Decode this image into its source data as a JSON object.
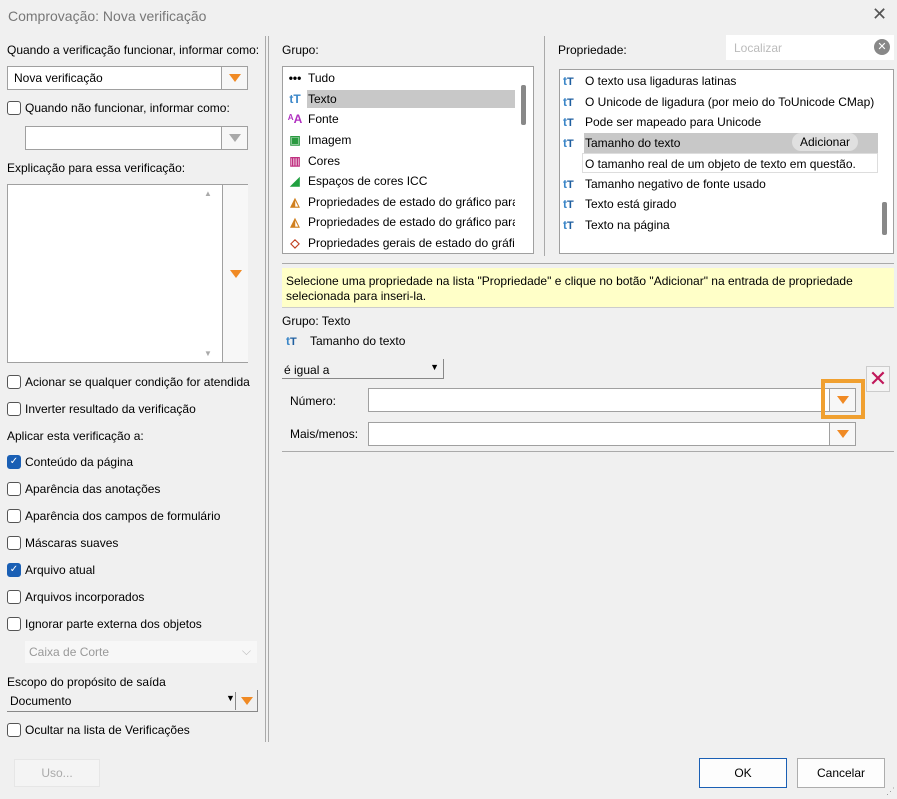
{
  "window": {
    "title": "Comprovação: Nova verificação",
    "close_icon": "close-icon"
  },
  "left": {
    "success_label": "Quando a verificação funcionar, informar como:",
    "success_value": "Nova verificação",
    "fail_label": "Quando não funcionar, informar como:",
    "fail_checked": false,
    "fail_value": "",
    "explanation_label": "Explicação para essa verificação:",
    "explanation_value": "",
    "options": [
      {
        "label": "Acionar se qualquer condição for atendida",
        "checked": false
      },
      {
        "label": "Inverter resultado da verificação",
        "checked": false
      }
    ],
    "apply_label": "Aplicar esta verificação a:",
    "apply": [
      {
        "label": "Conteúdo da página",
        "checked": true
      },
      {
        "label": "Aparência das anotações",
        "checked": false
      },
      {
        "label": "Aparência dos campos de formulário",
        "checked": false
      },
      {
        "label": "Máscaras suaves",
        "checked": false
      },
      {
        "label": "Arquivo atual",
        "checked": true
      },
      {
        "label": "Arquivos incorporados",
        "checked": false
      },
      {
        "label": "Ignorar parte externa dos objetos",
        "checked": false
      }
    ],
    "box_select": "Caixa de Corte",
    "scope_label": "Escopo do propósito de saída",
    "scope_value": "Documento",
    "hide_label": "Ocultar na lista de Verificações",
    "hide_checked": false,
    "usage_button": "Uso..."
  },
  "group": {
    "label": "Grupo:",
    "items": [
      {
        "label": "Tudo",
        "icon": "dots-icon"
      },
      {
        "label": "Texto",
        "icon": "text-icon",
        "selected": true
      },
      {
        "label": "Fonte",
        "icon": "font-icon"
      },
      {
        "label": "Imagem",
        "icon": "image-icon"
      },
      {
        "label": "Cores",
        "icon": "colors-icon"
      },
      {
        "label": "Espaços de cores ICC",
        "icon": "icc-icon"
      },
      {
        "label": "Propriedades de estado do gráfico para",
        "icon": "graphics-state-icon"
      },
      {
        "label": "Propriedades de estado do gráfico para",
        "icon": "graphics-state-icon"
      },
      {
        "label": "Propriedades gerais de estado do gráfi",
        "icon": "general-state-icon"
      }
    ]
  },
  "property": {
    "label": "Propriedade:",
    "search_placeholder": "Localizar",
    "items": [
      {
        "label": "O texto usa ligaduras latinas"
      },
      {
        "label": "O Unicode de ligadura (por meio do ToUnicode CMap)"
      },
      {
        "label": "Pode ser mapeado para Unicode"
      },
      {
        "label": "Tamanho do texto",
        "selected": true,
        "add_button": "Adicionar",
        "description": "O tamanho real de um objeto de texto em questão."
      },
      {
        "label": "Tamanho negativo de fonte usado"
      },
      {
        "label": "Texto está girado"
      },
      {
        "label": "Texto na página"
      }
    ]
  },
  "hint": "Selecione uma propriedade na lista \"Propriedade\" e clique no botão \"Adicionar\" na entrada de propriedade selecionada para inseri-la.",
  "condition": {
    "group_text": "Grupo: Texto",
    "property_name": "Tamanho do texto",
    "operator": "é igual a",
    "number_label": "Número:",
    "number_value": "",
    "plusminus_label": "Mais/menos:",
    "plusminus_value": ""
  },
  "footer": {
    "ok": "OK",
    "cancel": "Cancelar"
  },
  "colors": {
    "accent": "#f08a24",
    "highlight": "#f0a030",
    "hint_bg": "#ffffc8",
    "check": "#1a5fb4"
  }
}
